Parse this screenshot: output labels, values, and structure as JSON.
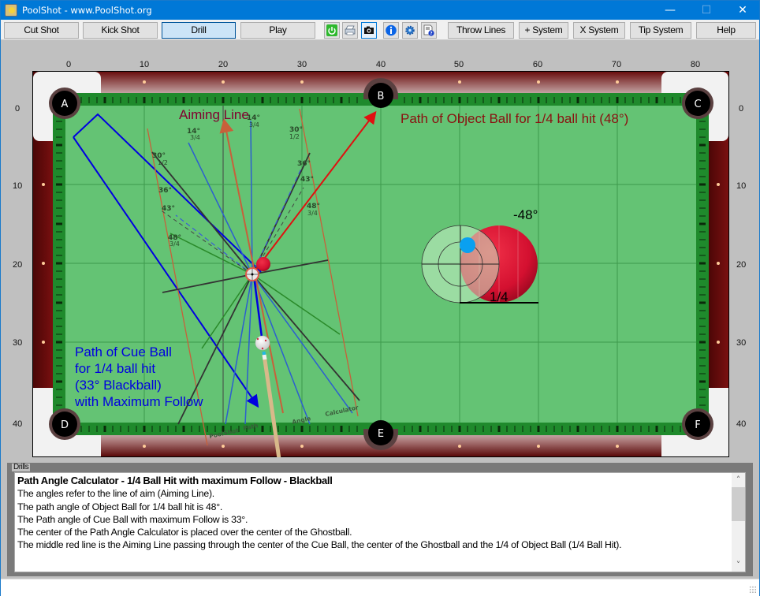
{
  "window": {
    "title": "PoolShot - www.PoolShot.org",
    "controls": {
      "minimize": "—",
      "maximize": "☐",
      "close": "✕"
    }
  },
  "toolbar": {
    "buttons": [
      {
        "label": "Cut Shot",
        "active": false
      },
      {
        "label": "Kick Shot",
        "active": false
      },
      {
        "label": "Drill",
        "active": true
      },
      {
        "label": "Play",
        "active": false
      }
    ],
    "icon_buttons": [
      {
        "name": "power-icon",
        "tooltip": ""
      },
      {
        "name": "printer-icon",
        "tooltip": ""
      },
      {
        "name": "camera-icon",
        "tooltip": ""
      },
      {
        "name": "info-icon",
        "tooltip": ""
      },
      {
        "name": "settings-gear-icon",
        "tooltip": ""
      },
      {
        "name": "help-document-icon",
        "tooltip": ""
      }
    ],
    "right_buttons": [
      {
        "label": "Throw Lines"
      },
      {
        "label": "+ System"
      },
      {
        "label": "X System"
      },
      {
        "label": "Tip System"
      },
      {
        "label": "Help"
      }
    ]
  },
  "rulers": {
    "x": [
      "0",
      "10",
      "20",
      "30",
      "40",
      "50",
      "60",
      "70",
      "80"
    ],
    "y_left": [
      "0",
      "10",
      "20",
      "30",
      "40"
    ],
    "y_right": [
      "0",
      "10",
      "20",
      "30",
      "40"
    ]
  },
  "table": {
    "pockets": [
      "A",
      "B",
      "C",
      "D",
      "E",
      "F"
    ],
    "colors": {
      "cloth": "#64c374",
      "rail": "#1f8a2c",
      "wood": "#5a0a0a",
      "corner": "#f2f2f2",
      "aiming_line": "#c8603a",
      "cue_path": "#0000e0",
      "object_path": "#e01010",
      "label_dark_red": "#800020"
    },
    "labels": {
      "aiming_line": "Aiming Line",
      "object_ball_path": "Path of Object Ball for 1/4 ball hit (48°)",
      "cue_ball_path": [
        "Path of Cue Ball",
        "for 1/4 ball hit",
        "(33° Blackball)",
        "with Maximum Follow"
      ],
      "calculator_watermark": [
        "PoolShot",
        "Path",
        "Angle",
        "Calculator"
      ]
    },
    "calculator_angles": [
      {
        "angle": "14°",
        "fraction": "3/4"
      },
      {
        "angle": "30°",
        "fraction": "1/2"
      },
      {
        "angle": "36°",
        "fraction": ""
      },
      {
        "angle": "43°",
        "fraction": ""
      },
      {
        "angle": "48°",
        "fraction": "3/4"
      }
    ],
    "hit_diagram": {
      "angle_label": "-48°",
      "fraction_label": "1/4"
    }
  },
  "drills": {
    "legend": "Drills",
    "heading": "Path Angle Calculator - 1/4 Ball Hit with maximum Follow - Blackball",
    "lines": [
      "The angles refer to the line of aim (Aiming Line).",
      "The path angle of Object Ball for 1/4 ball hit is 48°.",
      "The Path angle of Cue Ball with maximum Follow is 33°.",
      "The center of the Path Angle Calculator is placed over the center of the Ghostball.",
      "The middle red line is the Aiming Line passing through the center of the Cue Ball, the center of the Ghostball and the 1/4 of Object Ball (1/4 Ball Hit)."
    ],
    "scroll_up": "˄",
    "scroll_down": "˅"
  }
}
